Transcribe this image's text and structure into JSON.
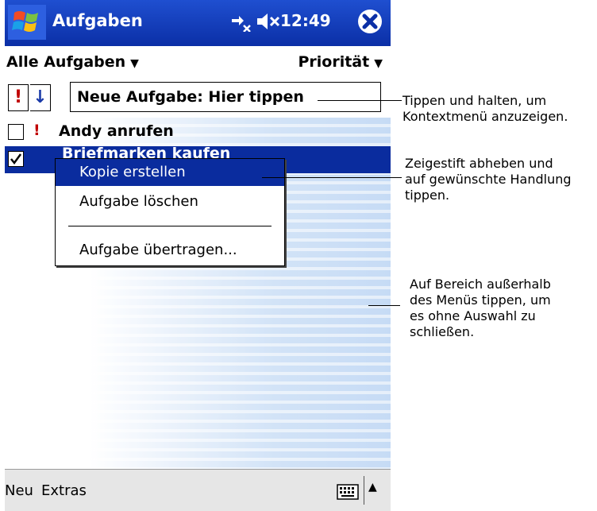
{
  "titlebar": {
    "app_title": "Aufgaben",
    "clock": "12:49",
    "icons": [
      "windows-start-icon",
      "connectivity-icon",
      "speaker-muted-icon",
      "close-icon"
    ]
  },
  "filter": {
    "category": "Alle Aufgaben",
    "sort": "Priorität"
  },
  "entry_bar": {
    "priority_symbol": "!",
    "sort_symbol": "↓",
    "new_task_text": "Neue Aufgabe: Hier tippen"
  },
  "tasks": [
    {
      "priority": "!",
      "label": "Andy anrufen",
      "checked": false
    },
    {
      "priority": "",
      "label": "Briefmarken kaufen",
      "checked": true,
      "selected": true
    }
  ],
  "context_menu": {
    "items": [
      "Kopie erstellen",
      "Aufgabe löschen",
      "Aufgabe übertragen..."
    ],
    "highlighted": "Kopie erstellen"
  },
  "bottom_bar": {
    "menu_new": "Neu",
    "menu_extras": "Extras",
    "sip_arrow": "▲"
  },
  "callouts": {
    "tap_hold": "Tippen und halten, um\nKontextmenü anzuzeigen.",
    "lift_stylus": "Zeigestift abheben und\nauf gewünschte Handlung\ntippen.",
    "tap_outside": "Auf Bereich außerhalb\ndes Menüs tippen, um\nes ohne Auswahl zu\nschließen."
  },
  "colors": {
    "titlebar": "#0b2fa6",
    "selection": "#0a2c9e",
    "priority": "#c00000"
  }
}
